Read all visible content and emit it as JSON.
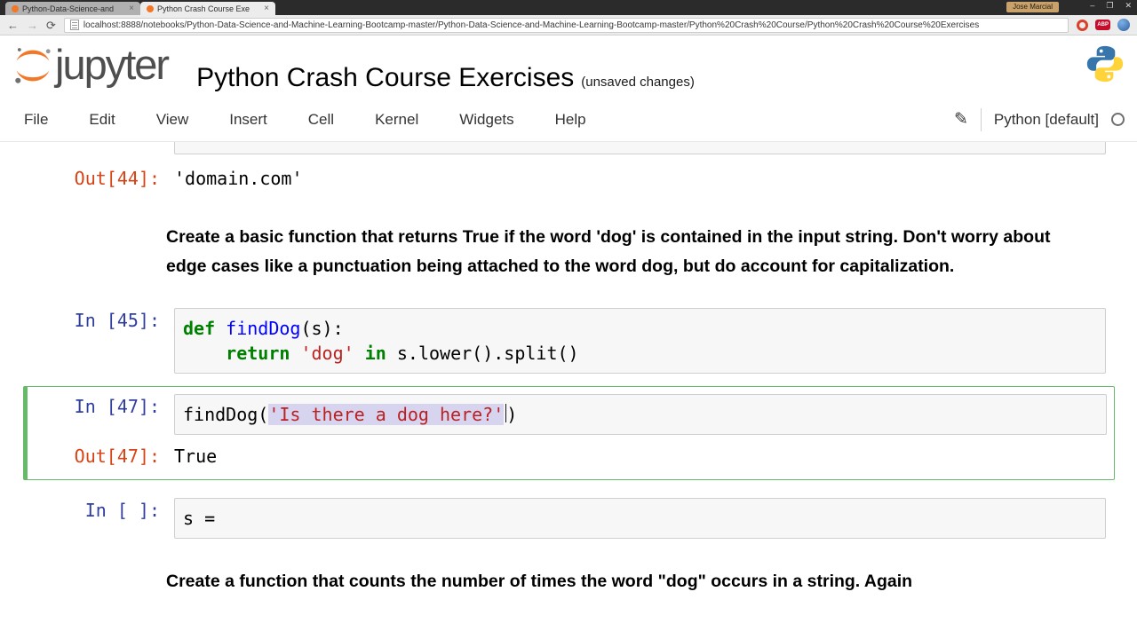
{
  "browser": {
    "tabs": [
      {
        "label": "Python-Data-Science-and",
        "close_glyph": "×"
      },
      {
        "label": "Python Crash Course Exe",
        "close_glyph": "×"
      }
    ],
    "profile_label": "Jose Marcial",
    "window_controls": {
      "minimize": "–",
      "maximize": "❐",
      "close": "✕"
    },
    "nav": {
      "back": "←",
      "forward": "→",
      "refresh": "⟳"
    },
    "url": "localhost:8888/notebooks/Python-Data-Science-and-Machine-Learning-Bootcamp-master/Python-Data-Science-and-Machine-Learning-Bootcamp-master/Python%20Crash%20Course/Python%20Crash%20Course%20Exercises",
    "extensions": {
      "abp_label": "ABP"
    }
  },
  "jupyter": {
    "logo_text": "jupyter",
    "title": "Python Crash Course Exercises",
    "autosave_status": "(unsaved changes)",
    "menu_items": [
      "File",
      "Edit",
      "View",
      "Insert",
      "Cell",
      "Kernel",
      "Widgets",
      "Help"
    ],
    "edit_mode_icon": "✎",
    "kernel_name": "Python [default]"
  },
  "notebook": {
    "out44": {
      "prompt": "Out[44]:",
      "value": "'domain.com'"
    },
    "markdown_dog": "Create a basic function that returns True if the word 'dog' is contained in the input string. Don't worry about edge cases like a punctuation being attached to the word dog, but do account for capitalization.",
    "in45": {
      "prompt": "In [45]:",
      "line1": [
        {
          "t": "def",
          "c": "kw"
        },
        {
          "t": " ",
          "c": "plain"
        },
        {
          "t": "findDog",
          "c": "fn"
        },
        {
          "t": "(s):",
          "c": "plain"
        }
      ],
      "line2": [
        {
          "t": "    ",
          "c": "plain"
        },
        {
          "t": "return",
          "c": "kw"
        },
        {
          "t": " ",
          "c": "plain"
        },
        {
          "t": "'dog'",
          "c": "str"
        },
        {
          "t": " ",
          "c": "plain"
        },
        {
          "t": "in",
          "c": "kw"
        },
        {
          "t": " s.lower().split()",
          "c": "plain"
        }
      ]
    },
    "in47": {
      "prompt": "In [47]:",
      "line1": [
        {
          "t": "findDog(",
          "c": "plain"
        },
        {
          "t": "'Is there a dog here?'",
          "c": "str-sel"
        },
        {
          "t": "",
          "c": "cursor"
        },
        {
          "t": ")",
          "c": "plain"
        }
      ]
    },
    "out47": {
      "prompt": "Out[47]:",
      "value": "True"
    },
    "in_blank": {
      "prompt": "In [ ]:",
      "line1": [
        {
          "t": "s =",
          "c": "plain"
        }
      ]
    },
    "markdown_count": "Create a function that counts the number of times the word \"dog\" occurs in a string. Again"
  },
  "colors": {
    "in_prompt": "#303f9f",
    "out_prompt": "#d84315",
    "selected_cell_border": "#66bb6a",
    "keyword": "#008000",
    "function_name": "#0000ff",
    "string": "#ba2121",
    "selection_highlight": "#d7d4f0",
    "jupyter_orange": "#f37726"
  }
}
